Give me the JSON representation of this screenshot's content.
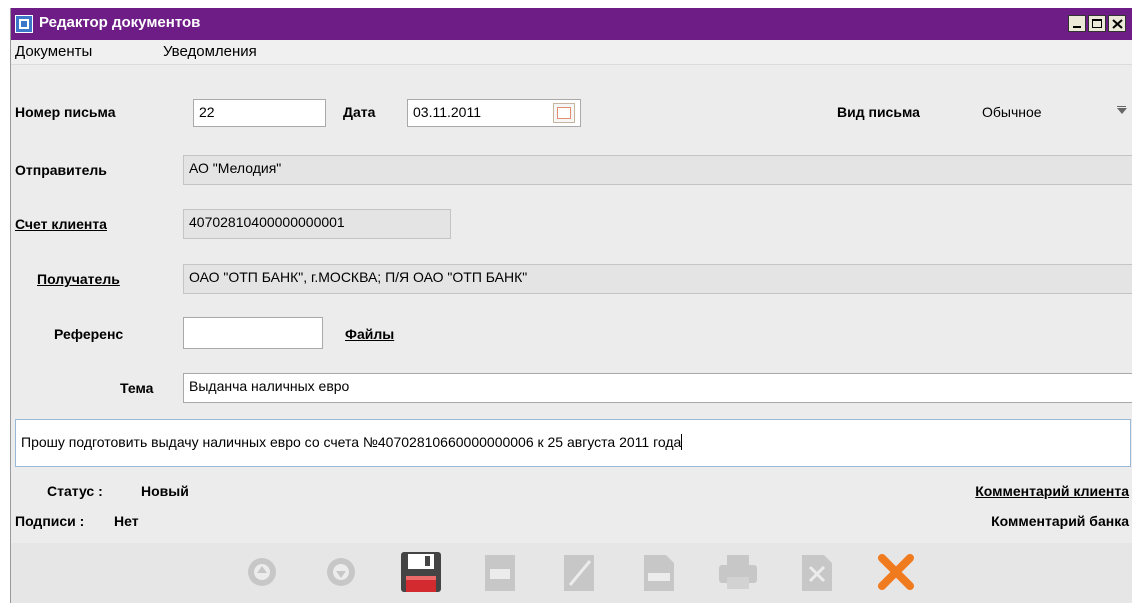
{
  "window": {
    "title": "Редактор документов"
  },
  "menu": {
    "items": [
      "Документы",
      "Уведомления"
    ]
  },
  "form": {
    "number_label": "Номер письма",
    "number_value": "22",
    "date_label": "Дата",
    "date_value": "03.11.2011",
    "type_label": "Вид письма",
    "type_value": "Обычное",
    "sender_label": "Отправитель",
    "sender_value": "АО \"Мелодия\"",
    "account_label": "Счет клиента",
    "account_value": "40702810400000000001",
    "recipient_label": "Получатель",
    "recipient_value": "ОАО \"ОТП БАНК\", г.МОСКВА; П/Я ОАО \"ОТП БАНК\"",
    "reference_label": "Референс",
    "reference_value": "",
    "files_label": "Файлы",
    "subject_label": "Тема",
    "subject_value": "Выданча наличных евро",
    "body_value": "Прошу подготовить выдачу наличных евро со счета №40702810660000000006 к 25 августа 2011 года"
  },
  "status": {
    "status_label": "Статус :",
    "status_value": "Новый",
    "signatures_label": "Подписи :",
    "signatures_value": "Нет",
    "client_comment_label": "Комментарий клиента",
    "bank_comment_label": "Комментарий банка"
  },
  "toolbar": {
    "icons": [
      "up-arrow-icon",
      "down-arrow-icon",
      "save-icon",
      "document-edit-icon",
      "sign-pen-icon",
      "copy-icon",
      "print-icon",
      "delete-doc-icon",
      "close-icon"
    ],
    "accent_close": "#f07a1e",
    "accent_save": "#c8232c"
  }
}
